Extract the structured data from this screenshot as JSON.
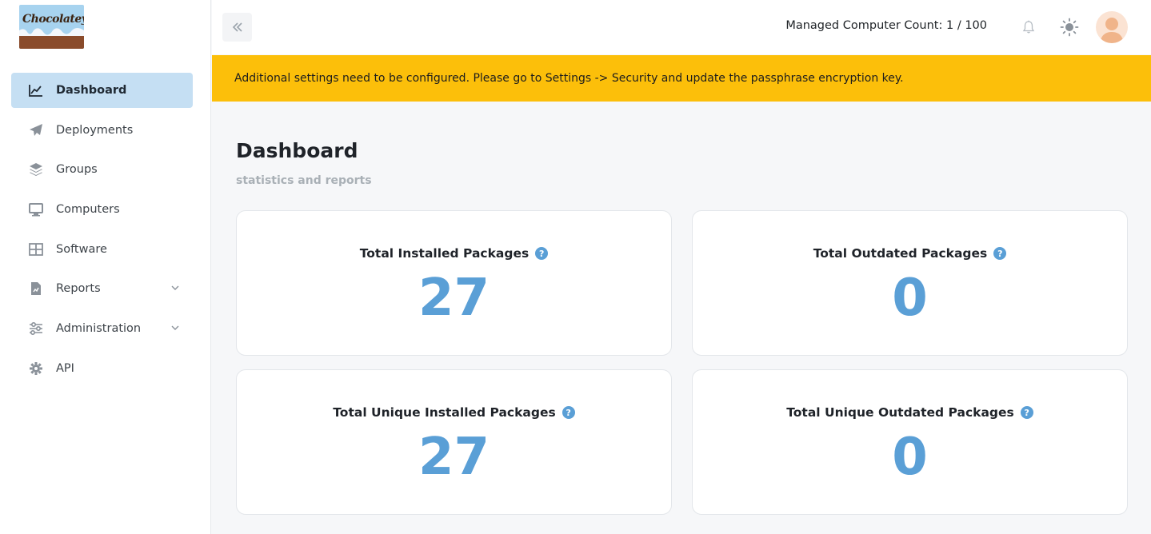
{
  "sidebar": {
    "logo_text": "Chocolatey",
    "items": [
      {
        "label": "Dashboard",
        "icon": "chart-line-icon",
        "active": true
      },
      {
        "label": "Deployments",
        "icon": "paper-plane-icon"
      },
      {
        "label": "Groups",
        "icon": "layers-icon"
      },
      {
        "label": "Computers",
        "icon": "monitor-icon"
      },
      {
        "label": "Software",
        "icon": "grid-icon"
      },
      {
        "label": "Reports",
        "icon": "report-file-icon",
        "expandable": true
      },
      {
        "label": "Administration",
        "icon": "sliders-icon",
        "expandable": true
      },
      {
        "label": "API",
        "icon": "gear-icon"
      }
    ]
  },
  "topbar": {
    "collapse_icon": "double-chevron-left-icon",
    "managed_count": "Managed Computer Count: 1 / 100",
    "notification_icon": "bell-icon",
    "theme_icon": "sun-icon",
    "avatar_icon": "user-avatar-icon"
  },
  "alert": {
    "message": "Additional settings need to be configured. Please go to Settings -> Security and update the passphrase encryption key.",
    "color": "#fcbf0a"
  },
  "page": {
    "title": "Dashboard",
    "subtitle": "statistics and reports"
  },
  "cards": [
    {
      "title": "Total Installed Packages",
      "value": "27"
    },
    {
      "title": "Total Outdated Packages",
      "value": "0"
    },
    {
      "title": "Total Unique Installed Packages",
      "value": "27"
    },
    {
      "title": "Total Unique Outdated Packages",
      "value": "0"
    }
  ],
  "colors": {
    "accent": "#5a9fd6",
    "active_nav": "#c5dff3"
  }
}
